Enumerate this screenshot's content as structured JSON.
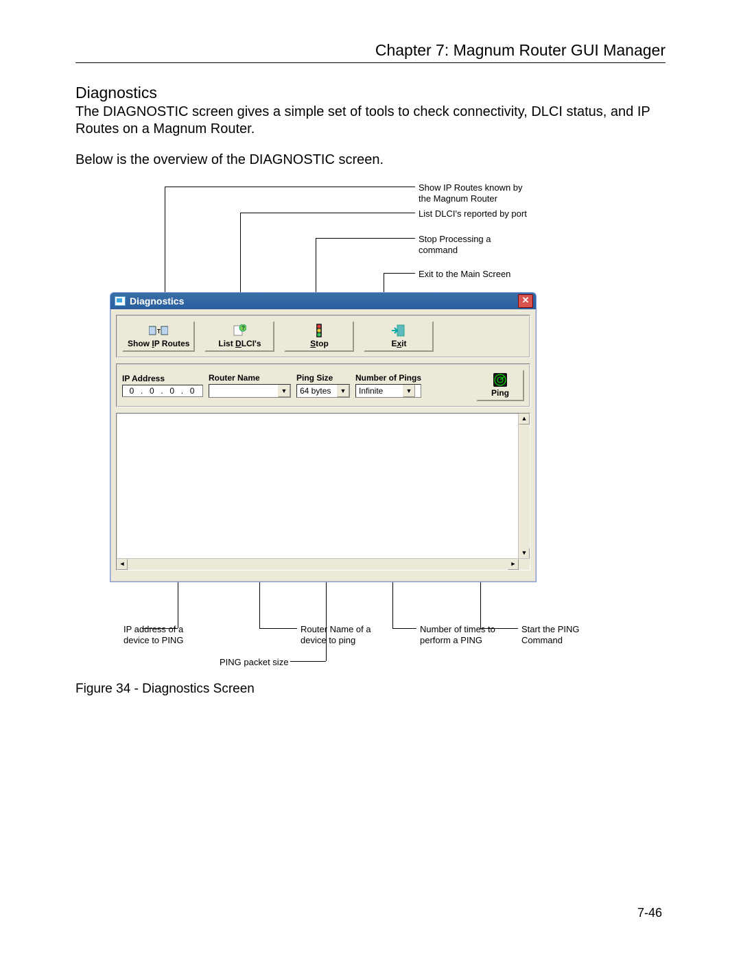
{
  "chapter_title": "Chapter 7: Magnum Router GUI Manager",
  "section_title": "Diagnostics",
  "intro_para": "The DIAGNOSTIC screen gives a simple set of tools to check connectivity, DLCI status, and IP Routes on a Magnum Router.",
  "overview_line": "Below is the overview of the DIAGNOSTIC screen.",
  "figure_caption": "Figure 34 - Diagnostics Screen",
  "page_number": "7-46",
  "annot_top": {
    "routes": "Show IP Routes known by the Magnum Router",
    "dlci": "List DLCI's reported by port",
    "stop": "Stop Processing a command",
    "exit": "Exit to the Main Screen"
  },
  "annot_bottom": {
    "ip": "IP address of a device to PING",
    "router": "Router Name of a device to ping",
    "pingsize": "PING packet size",
    "numpings": "Number of times to perform a PING",
    "ping": "Start the PING Command"
  },
  "window": {
    "title": "Diagnostics",
    "toolbar": {
      "show_routes": {
        "pre": "Show ",
        "ul": "I",
        "post": "P Routes"
      },
      "list_dlcis": {
        "pre": "List ",
        "ul": "D",
        "post": "LCI's"
      },
      "stop": {
        "ul": "S",
        "post": "top"
      },
      "exit": {
        "pre": "E",
        "ul": "x",
        "post": "it"
      }
    },
    "fields": {
      "ip_label": "IP Address",
      "ip_value": [
        "0",
        "0",
        "0",
        "0"
      ],
      "router_label": "Router Name",
      "router_value": "",
      "pingsize_label": "Ping Size",
      "pingsize_value": "64 bytes",
      "numpings_label": "Number of Pings",
      "numpings_value": "Infinite",
      "ping_btn": {
        "ul": "P",
        "post": "ing"
      }
    }
  }
}
